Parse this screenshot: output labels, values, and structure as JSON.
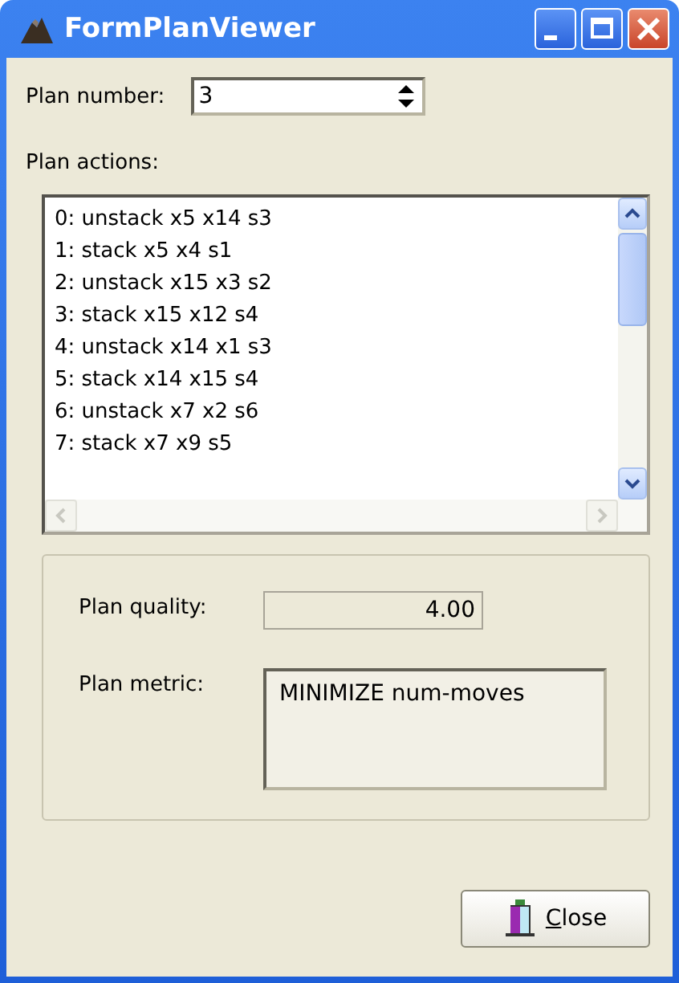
{
  "window": {
    "title": "FormPlanViewer"
  },
  "plan_number": {
    "label": "Plan number:",
    "value": "3"
  },
  "plan_actions": {
    "label": "Plan actions:",
    "items": [
      "0: unstack x5 x14 s3",
      "1: stack x5 x4 s1",
      "2: unstack x15 x3 s2",
      "3: stack x15 x12 s4",
      "4: unstack x14 x1 s3",
      "5: stack x14 x15 s4",
      "6: unstack x7 x2 s6",
      "7: stack x7 x9 s5"
    ]
  },
  "plan_quality": {
    "label": "Plan quality:",
    "value": "4.00"
  },
  "plan_metric": {
    "label": "Plan metric:",
    "value": "MINIMIZE num-moves"
  },
  "buttons": [
    {
      "label": "Close"
    }
  ]
}
